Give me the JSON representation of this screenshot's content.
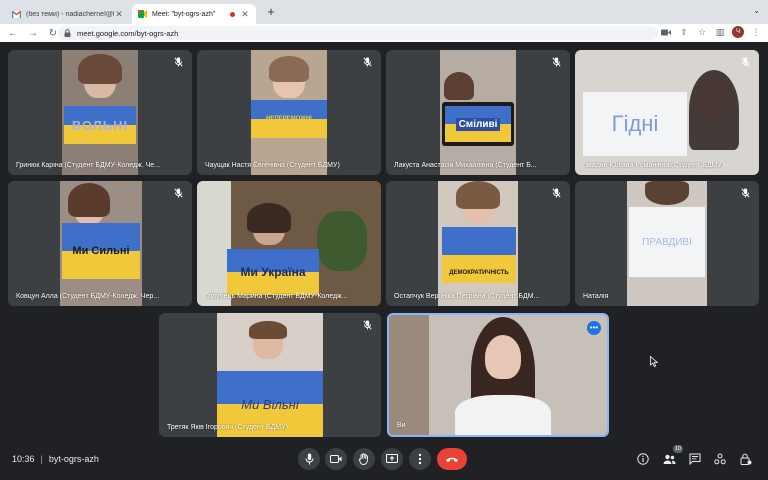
{
  "browser": {
    "tabs": [
      {
        "title": "(без теми) - nadiacherneї@b",
        "favicon": "gmail-icon"
      },
      {
        "title": "Meet: \"byt-ogrs-azh\"",
        "favicon": "meet-icon",
        "recording": true
      }
    ],
    "url": "meet.google.com/byt-ogrs-azh",
    "profile_initial": "Ч"
  },
  "meeting": {
    "time": "10:36",
    "separator": "|",
    "code": "byt-ogrs-azh",
    "participant_count": "10"
  },
  "participants": [
    {
      "name": "Гринюк Каріна (Студент БДМУ-Коледж. Че...",
      "sign": "ВОЛЬНІ",
      "muted": true
    },
    {
      "name": "Чаущак Настя Євгенівна (Студент БДМУ)",
      "sign": "НЕПЕРЕМОЖНІ",
      "muted": true
    },
    {
      "name": "Лакуста Анастасія Михайлівна (Студент Б...",
      "sign": "Сміливі",
      "muted": true
    },
    {
      "name": "Ізвадян Юліана Романівна (Студент БДМУ)",
      "sign": "Гідні",
      "muted": true
    },
    {
      "name": "Ковцун Алла (Студент БДМУ-Коледж. Чер...",
      "sign": "Ми Сильні",
      "muted": true
    },
    {
      "name": "Голубець Марина (Студент БДМУ-Коледж...",
      "sign": "Ми Україна",
      "muted": true
    },
    {
      "name": "Остапчук Вероніка Петрівна (Студент БДМ...",
      "sign": "ДЕМОКРАТИЧНІСТЬ",
      "muted": true
    },
    {
      "name": "Наталія",
      "sign": "ПРАВДИВІ",
      "muted": true
    },
    {
      "name": "Третяк Яків Ігорович (Студент БДМУ)",
      "sign": "Ми Вільні",
      "muted": true
    },
    {
      "name": "Ви",
      "sign": "",
      "muted": false,
      "self": true
    }
  ],
  "colors": {
    "background": "#202124",
    "tile": "#3c4043",
    "leave": "#ea4335",
    "accent": "#1a73e8",
    "flag_blue": "#3e6fc9",
    "flag_yellow": "#f1c83a"
  }
}
